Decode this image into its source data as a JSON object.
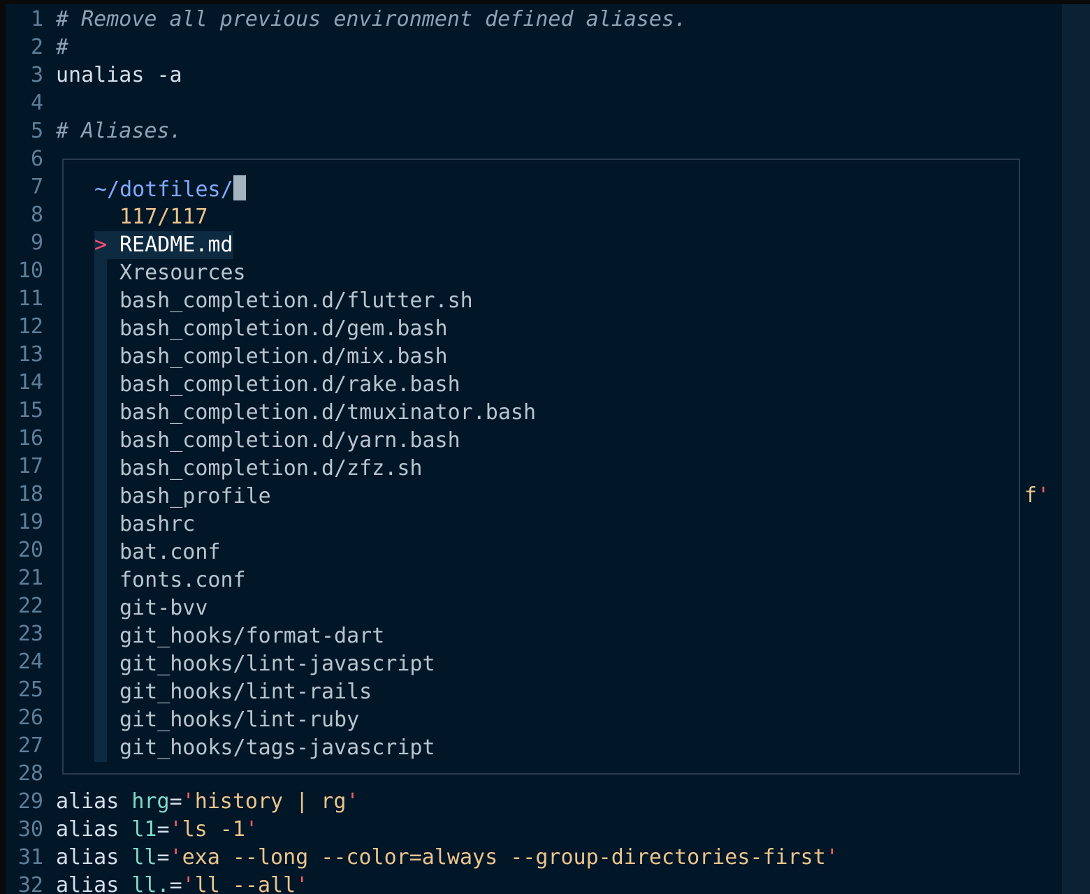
{
  "editor": {
    "lines": [
      {
        "n": "1",
        "parts": [
          {
            "t": "# Remove all previous environment defined aliases.",
            "c": "comment"
          }
        ]
      },
      {
        "n": "2",
        "parts": [
          {
            "t": "#",
            "c": "comment"
          }
        ]
      },
      {
        "n": "3",
        "parts": [
          {
            "t": "unalias -a",
            "c": "plain"
          }
        ]
      },
      {
        "n": "4",
        "parts": []
      },
      {
        "n": "5",
        "parts": [
          {
            "t": "# Aliases.",
            "c": "comment"
          }
        ]
      },
      {
        "n": "6",
        "parts": []
      },
      {
        "n": "7",
        "parts": []
      },
      {
        "n": "8",
        "parts": []
      },
      {
        "n": "9",
        "parts": []
      },
      {
        "n": "10",
        "parts": []
      },
      {
        "n": "11",
        "parts": []
      },
      {
        "n": "12",
        "parts": []
      },
      {
        "n": "13",
        "parts": []
      },
      {
        "n": "14",
        "parts": []
      },
      {
        "n": "15",
        "parts": []
      },
      {
        "n": "16",
        "parts": []
      },
      {
        "n": "17",
        "parts": []
      },
      {
        "n": "18",
        "parts": []
      },
      {
        "n": "19",
        "parts": []
      },
      {
        "n": "20",
        "parts": []
      },
      {
        "n": "21",
        "parts": []
      },
      {
        "n": "22",
        "parts": []
      },
      {
        "n": "23",
        "parts": []
      },
      {
        "n": "24",
        "parts": []
      },
      {
        "n": "25",
        "parts": []
      },
      {
        "n": "26",
        "parts": []
      },
      {
        "n": "27",
        "parts": []
      },
      {
        "n": "28",
        "parts": []
      },
      {
        "n": "29",
        "parts": [
          {
            "t": "alias ",
            "c": "plain"
          },
          {
            "t": "hrg",
            "c": "alias-name"
          },
          {
            "t": "=",
            "c": "plain"
          },
          {
            "t": "'",
            "c": "quote"
          },
          {
            "t": "history | rg",
            "c": "str"
          },
          {
            "t": "'",
            "c": "quote"
          }
        ]
      },
      {
        "n": "30",
        "parts": [
          {
            "t": "alias ",
            "c": "plain"
          },
          {
            "t": "l1",
            "c": "alias-name"
          },
          {
            "t": "=",
            "c": "plain"
          },
          {
            "t": "'",
            "c": "quote"
          },
          {
            "t": "ls -1",
            "c": "str"
          },
          {
            "t": "'",
            "c": "quote"
          }
        ]
      },
      {
        "n": "31",
        "parts": [
          {
            "t": "alias ",
            "c": "plain"
          },
          {
            "t": "ll",
            "c": "alias-name"
          },
          {
            "t": "=",
            "c": "plain"
          },
          {
            "t": "'",
            "c": "quote"
          },
          {
            "t": "exa --long --color=always --group-directories-first",
            "c": "str"
          },
          {
            "t": "'",
            "c": "quote"
          }
        ]
      },
      {
        "n": "32",
        "parts": [
          {
            "t": "alias ",
            "c": "plain"
          },
          {
            "t": "ll.",
            "c": "alias-name"
          },
          {
            "t": "=",
            "c": "plain"
          },
          {
            "t": "'",
            "c": "quote"
          },
          {
            "t": "ll --all",
            "c": "str"
          },
          {
            "t": "'",
            "c": "quote"
          }
        ]
      }
    ],
    "stray_fragment": {
      "f": "f",
      "q": "'"
    }
  },
  "finder": {
    "query": "~/dotfiles/",
    "counter": "117/117",
    "selected_marker": ">",
    "results": [
      "README.md",
      "Xresources",
      "bash_completion.d/flutter.sh",
      "bash_completion.d/gem.bash",
      "bash_completion.d/mix.bash",
      "bash_completion.d/rake.bash",
      "bash_completion.d/tmuxinator.bash",
      "bash_completion.d/yarn.bash",
      "bash_completion.d/zfz.sh",
      "bash_profile",
      "bashrc",
      "bat.conf",
      "fonts.conf",
      "git-bvv",
      "git_hooks/format-dart",
      "git_hooks/lint-javascript",
      "git_hooks/lint-rails",
      "git_hooks/lint-ruby",
      "git_hooks/tags-javascript"
    ]
  },
  "colors": {
    "background": "#011627",
    "comment": "#8da4b8",
    "string": "#ecc48d",
    "alias_name": "#7fdbca",
    "quote": "#ef5f6b",
    "path": "#82aaff",
    "marker": "#ff4f7a"
  }
}
